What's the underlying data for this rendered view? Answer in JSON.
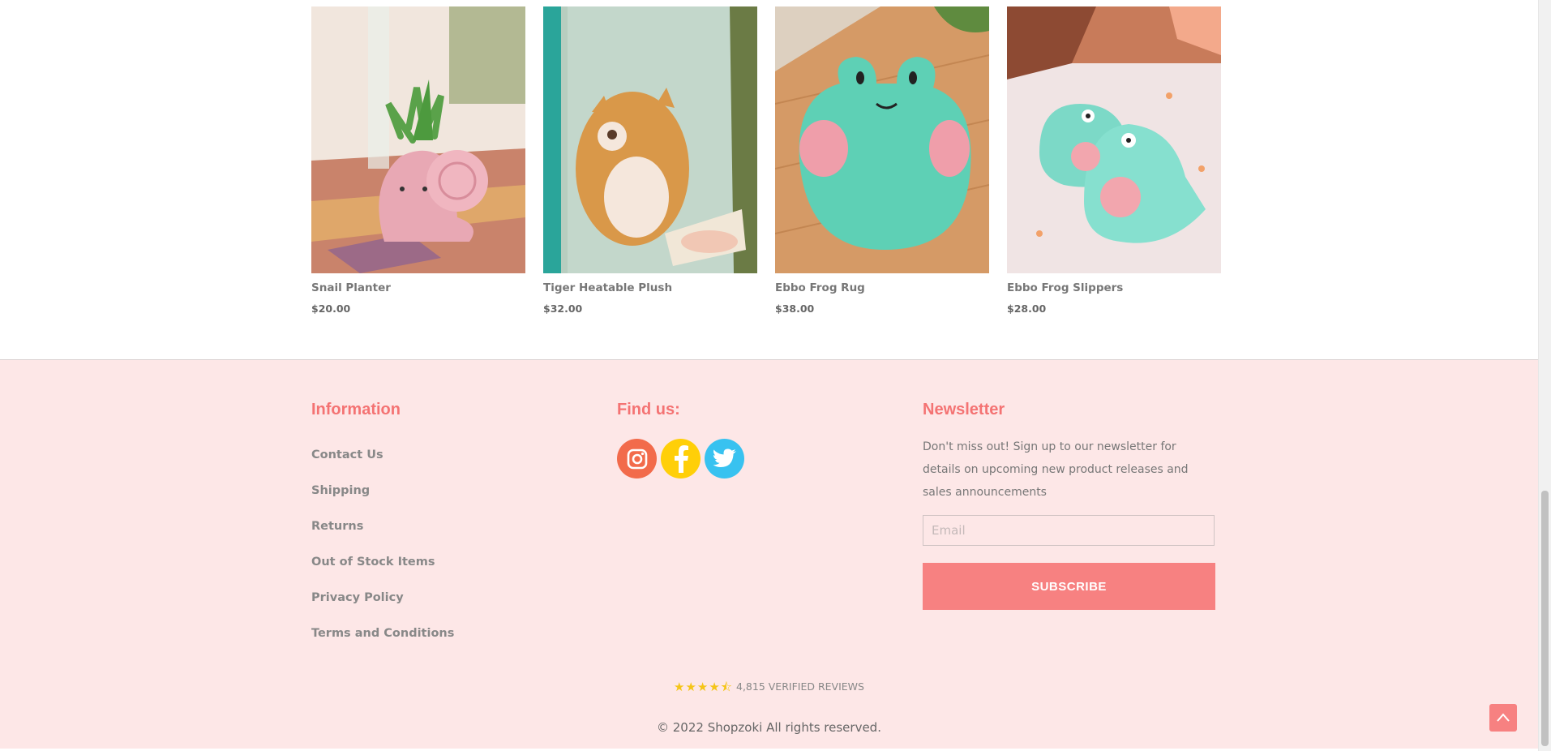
{
  "products": [
    {
      "name": "Snail Planter",
      "price": "$20.00"
    },
    {
      "name": "Tiger Heatable Plush",
      "price": "$32.00"
    },
    {
      "name": "Ebbo Frog Rug",
      "price": "$38.00"
    },
    {
      "name": "Ebbo Frog Slippers",
      "price": "$28.00"
    }
  ],
  "footer": {
    "info_title": "Information",
    "links": [
      "Contact Us",
      "Shipping",
      "Returns",
      "Out of Stock Items",
      "Privacy Policy",
      "Terms and Conditions"
    ],
    "find_title": "Find us:",
    "socials": [
      "instagram-icon",
      "facebook-icon",
      "twitter-icon"
    ],
    "news_title": "Newsletter",
    "news_text": "Don't miss out! Sign up to our newsletter for details on upcoming new product releases and sales announcements",
    "email_placeholder": "Email",
    "subscribe_label": "SUBSCRIBE",
    "reviews_count": "4,815 VERIFIED REVIEWS",
    "rating": 4.5,
    "copyright": "© 2022 Shopzoki All rights reserved."
  },
  "colors": {
    "accent": "#f47373",
    "button": "#f78181",
    "footer_bg": "#fde7e7",
    "star": "#f5c518"
  }
}
